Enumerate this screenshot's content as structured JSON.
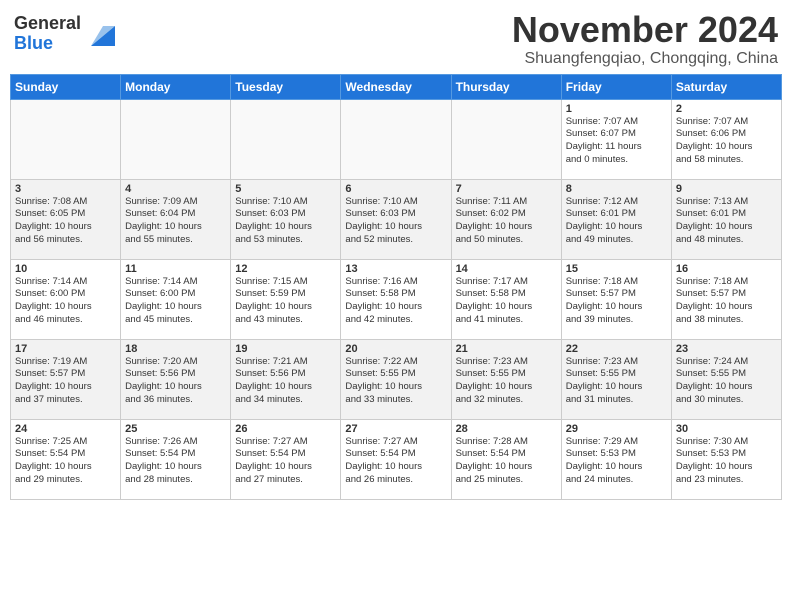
{
  "header": {
    "logo_general": "General",
    "logo_blue": "Blue",
    "month_title": "November 2024",
    "location": "Shuangfengqiao, Chongqing, China"
  },
  "weekdays": [
    "Sunday",
    "Monday",
    "Tuesday",
    "Wednesday",
    "Thursday",
    "Friday",
    "Saturday"
  ],
  "weeks": [
    [
      {
        "day": "",
        "info": ""
      },
      {
        "day": "",
        "info": ""
      },
      {
        "day": "",
        "info": ""
      },
      {
        "day": "",
        "info": ""
      },
      {
        "day": "",
        "info": ""
      },
      {
        "day": "1",
        "info": "Sunrise: 7:07 AM\nSunset: 6:07 PM\nDaylight: 11 hours\nand 0 minutes."
      },
      {
        "day": "2",
        "info": "Sunrise: 7:07 AM\nSunset: 6:06 PM\nDaylight: 10 hours\nand 58 minutes."
      }
    ],
    [
      {
        "day": "3",
        "info": "Sunrise: 7:08 AM\nSunset: 6:05 PM\nDaylight: 10 hours\nand 56 minutes."
      },
      {
        "day": "4",
        "info": "Sunrise: 7:09 AM\nSunset: 6:04 PM\nDaylight: 10 hours\nand 55 minutes."
      },
      {
        "day": "5",
        "info": "Sunrise: 7:10 AM\nSunset: 6:03 PM\nDaylight: 10 hours\nand 53 minutes."
      },
      {
        "day": "6",
        "info": "Sunrise: 7:10 AM\nSunset: 6:03 PM\nDaylight: 10 hours\nand 52 minutes."
      },
      {
        "day": "7",
        "info": "Sunrise: 7:11 AM\nSunset: 6:02 PM\nDaylight: 10 hours\nand 50 minutes."
      },
      {
        "day": "8",
        "info": "Sunrise: 7:12 AM\nSunset: 6:01 PM\nDaylight: 10 hours\nand 49 minutes."
      },
      {
        "day": "9",
        "info": "Sunrise: 7:13 AM\nSunset: 6:01 PM\nDaylight: 10 hours\nand 48 minutes."
      }
    ],
    [
      {
        "day": "10",
        "info": "Sunrise: 7:14 AM\nSunset: 6:00 PM\nDaylight: 10 hours\nand 46 minutes."
      },
      {
        "day": "11",
        "info": "Sunrise: 7:14 AM\nSunset: 6:00 PM\nDaylight: 10 hours\nand 45 minutes."
      },
      {
        "day": "12",
        "info": "Sunrise: 7:15 AM\nSunset: 5:59 PM\nDaylight: 10 hours\nand 43 minutes."
      },
      {
        "day": "13",
        "info": "Sunrise: 7:16 AM\nSunset: 5:58 PM\nDaylight: 10 hours\nand 42 minutes."
      },
      {
        "day": "14",
        "info": "Sunrise: 7:17 AM\nSunset: 5:58 PM\nDaylight: 10 hours\nand 41 minutes."
      },
      {
        "day": "15",
        "info": "Sunrise: 7:18 AM\nSunset: 5:57 PM\nDaylight: 10 hours\nand 39 minutes."
      },
      {
        "day": "16",
        "info": "Sunrise: 7:18 AM\nSunset: 5:57 PM\nDaylight: 10 hours\nand 38 minutes."
      }
    ],
    [
      {
        "day": "17",
        "info": "Sunrise: 7:19 AM\nSunset: 5:57 PM\nDaylight: 10 hours\nand 37 minutes."
      },
      {
        "day": "18",
        "info": "Sunrise: 7:20 AM\nSunset: 5:56 PM\nDaylight: 10 hours\nand 36 minutes."
      },
      {
        "day": "19",
        "info": "Sunrise: 7:21 AM\nSunset: 5:56 PM\nDaylight: 10 hours\nand 34 minutes."
      },
      {
        "day": "20",
        "info": "Sunrise: 7:22 AM\nSunset: 5:55 PM\nDaylight: 10 hours\nand 33 minutes."
      },
      {
        "day": "21",
        "info": "Sunrise: 7:23 AM\nSunset: 5:55 PM\nDaylight: 10 hours\nand 32 minutes."
      },
      {
        "day": "22",
        "info": "Sunrise: 7:23 AM\nSunset: 5:55 PM\nDaylight: 10 hours\nand 31 minutes."
      },
      {
        "day": "23",
        "info": "Sunrise: 7:24 AM\nSunset: 5:55 PM\nDaylight: 10 hours\nand 30 minutes."
      }
    ],
    [
      {
        "day": "24",
        "info": "Sunrise: 7:25 AM\nSunset: 5:54 PM\nDaylight: 10 hours\nand 29 minutes."
      },
      {
        "day": "25",
        "info": "Sunrise: 7:26 AM\nSunset: 5:54 PM\nDaylight: 10 hours\nand 28 minutes."
      },
      {
        "day": "26",
        "info": "Sunrise: 7:27 AM\nSunset: 5:54 PM\nDaylight: 10 hours\nand 27 minutes."
      },
      {
        "day": "27",
        "info": "Sunrise: 7:27 AM\nSunset: 5:54 PM\nDaylight: 10 hours\nand 26 minutes."
      },
      {
        "day": "28",
        "info": "Sunrise: 7:28 AM\nSunset: 5:54 PM\nDaylight: 10 hours\nand 25 minutes."
      },
      {
        "day": "29",
        "info": "Sunrise: 7:29 AM\nSunset: 5:53 PM\nDaylight: 10 hours\nand 24 minutes."
      },
      {
        "day": "30",
        "info": "Sunrise: 7:30 AM\nSunset: 5:53 PM\nDaylight: 10 hours\nand 23 minutes."
      }
    ]
  ]
}
